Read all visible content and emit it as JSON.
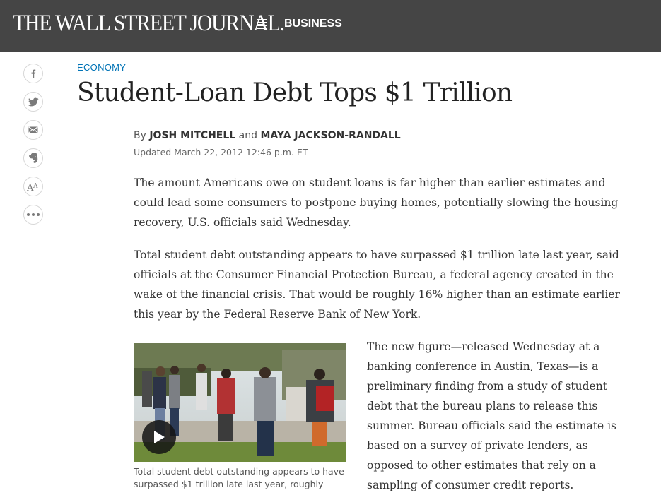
{
  "header": {
    "logo_text": "THE WALL STREET JOURNAL.",
    "menu_icon": "hamburger-menu-icon",
    "section_label": "BUSINESS",
    "background_color": "#454545"
  },
  "share_bar": [
    {
      "name": "facebook",
      "icon": "facebook-icon"
    },
    {
      "name": "twitter",
      "icon": "twitter-icon"
    },
    {
      "name": "email",
      "icon": "email-icon"
    },
    {
      "name": "evernote",
      "icon": "evernote-icon"
    },
    {
      "name": "text-size",
      "icon": "text-size-icon"
    },
    {
      "name": "more",
      "icon": "more-dots-icon"
    }
  ],
  "article": {
    "kicker": "ECONOMY",
    "headline": "Student-Loan Debt Tops $1 Trillion",
    "byline_prefix": "By",
    "author1": "JOSH MITCHELL",
    "byline_and": "and",
    "author2": "MAYA JACKSON-RANDALL",
    "updated": "Updated March 22, 2012 12:46 p.m. ET",
    "paragraphs": [
      "The amount Americans owe on student loans is far higher than earlier estimates and could lead some consumers to postpone buying homes, potentially slowing the housing recovery, U.S. officials said Wednesday.",
      "Total student debt outstanding appears to have surpassed $1 trillion late last year, said officials at the Consumer Financial Protection Bureau, a federal agency created in the wake of the financial crisis. That would be roughly 16% higher than an estimate earlier this year by the Federal Reserve Bank of New York.",
      "The new figure—released Wednesday at a banking conference in Austin, Texas—is a preliminary finding from a study of student debt that the bureau plans to release this summer. Bureau officials said the estimate is based on a survey of private lenders, as opposed to other estimates that rely on a sampling of consumer credit reports."
    ],
    "photo_caption": "Total student debt outstanding appears to have surpassed $1 trillion late last year, roughly",
    "video_icon": "play-icon"
  },
  "colors": {
    "accent_link": "#0274b6",
    "headline_text": "#222222",
    "body_text": "#333333"
  }
}
